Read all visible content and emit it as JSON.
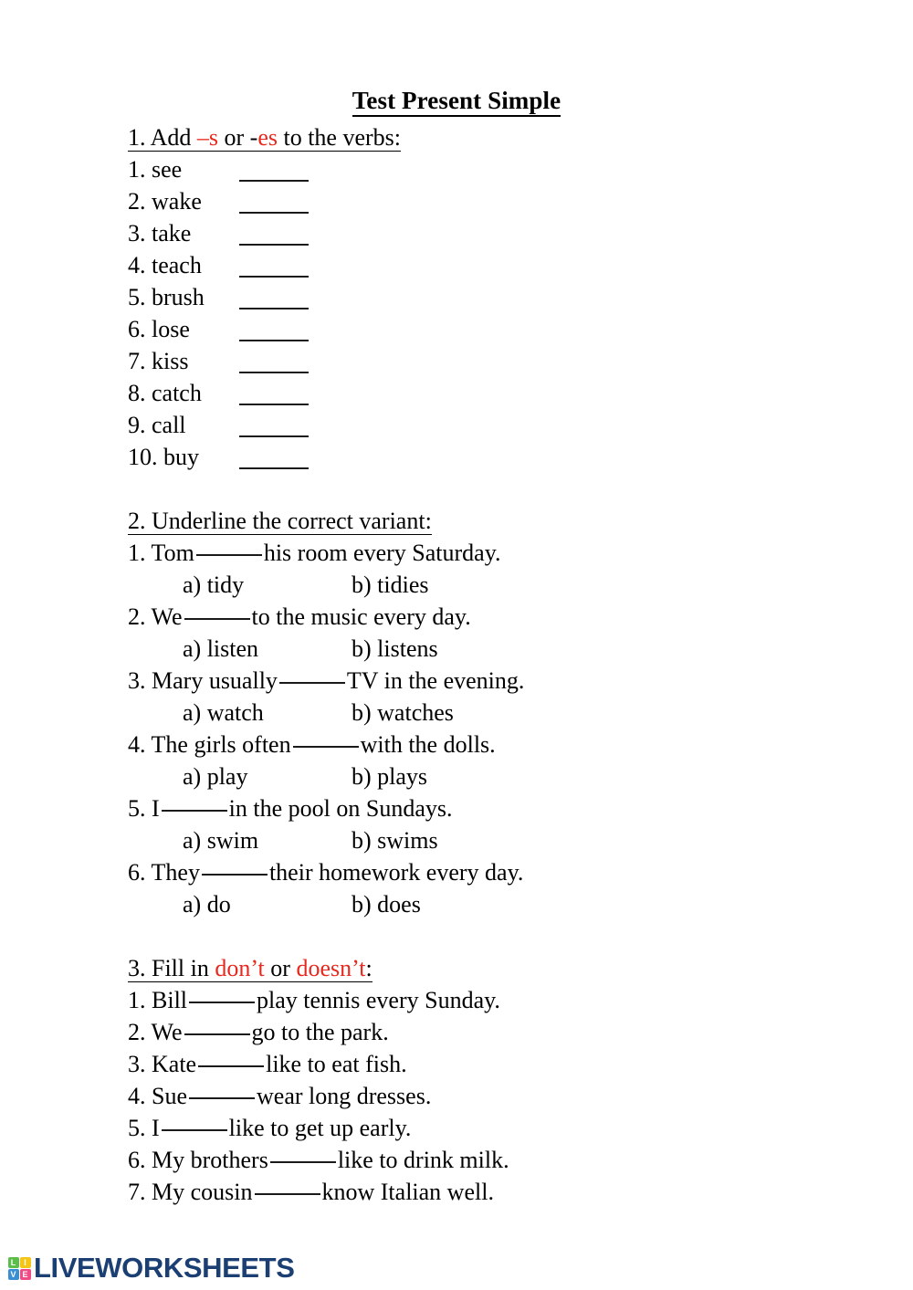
{
  "document": {
    "title": "Test Present Simple"
  },
  "exercise1": {
    "heading_prefix": "1. Add ",
    "heading_red1": "–s",
    "heading_mid": " or ",
    "heading_dash2": "-",
    "heading_red2": "es",
    "heading_suffix": " to the verbs:",
    "items": [
      {
        "num": "1.",
        "verb": "see"
      },
      {
        "num": "2.",
        "verb": "wake"
      },
      {
        "num": "3.",
        "verb": "take"
      },
      {
        "num": "4.",
        "verb": "teach"
      },
      {
        "num": "5.",
        "verb": "brush"
      },
      {
        "num": "6.",
        "verb": "lose"
      },
      {
        "num": "7.",
        "verb": "kiss"
      },
      {
        "num": "8.",
        "verb": "catch"
      },
      {
        "num": "9.",
        "verb": "call"
      },
      {
        "num": "10.",
        "verb": "buy"
      }
    ]
  },
  "exercise2": {
    "heading": "2. Underline the correct variant:",
    "items": [
      {
        "num": "1.",
        "before": "Tom",
        "after": "his room every Saturday.",
        "option_a": "a) tidy",
        "option_b": "b) tidies"
      },
      {
        "num": "2.",
        "before": "We",
        "after": "to the music every day.",
        "option_a": "a) listen",
        "option_b": "b) listens"
      },
      {
        "num": "3.",
        "before": "Mary usually",
        "after": "TV in the evening.",
        "option_a": "a) watch",
        "option_b": "b) watches"
      },
      {
        "num": "4.",
        "before": "The girls often",
        "after": "with the dolls.",
        "option_a": "a) play",
        "option_b": "b) plays"
      },
      {
        "num": "5.",
        "before": "I",
        "after": "in the pool on Sundays.",
        "option_a": "a) swim",
        "option_b": "b) swims"
      },
      {
        "num": "6.",
        "before": "They",
        "after": "their homework every day.",
        "option_a": "a) do",
        "option_b": "b) does"
      }
    ]
  },
  "exercise3": {
    "heading_prefix": "3. Fill in ",
    "heading_red1": "don’t",
    "heading_mid": " or ",
    "heading_red2": "doesn’t",
    "heading_suffix": ":",
    "items": [
      {
        "num": "1.",
        "before": "Bill",
        "after": "play tennis every Sunday."
      },
      {
        "num": "2.",
        "before": "We",
        "after": "go to the park."
      },
      {
        "num": "3.",
        "before": "Kate",
        "after": "like to eat fish."
      },
      {
        "num": "4.",
        "before": "Sue",
        "after": "wear long dresses."
      },
      {
        "num": "5.",
        "before": "I",
        "after": "like to get up early."
      },
      {
        "num": "6.",
        "before": "My brothers",
        "after": "like to drink milk."
      },
      {
        "num": "7.",
        "before": "My cousin",
        "after": "know Italian well."
      }
    ]
  },
  "footer": {
    "brand": "LIVEWORKSHEETS",
    "logo_letters": [
      "L",
      "I",
      "V",
      "E"
    ],
    "brand_color": "#1b3f73",
    "accent_red": "#e8281e"
  }
}
